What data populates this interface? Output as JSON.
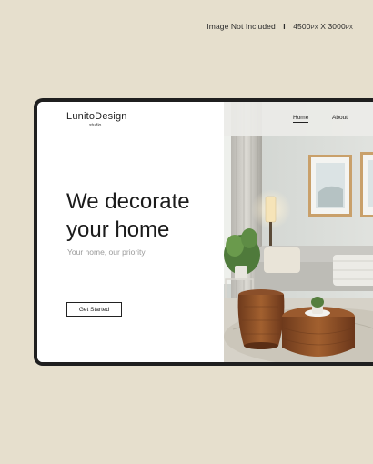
{
  "caption": {
    "text": "Image Not Included",
    "separator": "I",
    "dims_a": "4500",
    "unit_a": "PX",
    "times": " X ",
    "dims_b": "3000",
    "unit_b": "PX"
  },
  "brand": {
    "name": "LunitoDesign",
    "tagline": "studio"
  },
  "hero": {
    "title_line1": "We decorate",
    "title_line2": "your home",
    "subtitle": "Your home, our priority",
    "cta_label": "Get Started"
  },
  "nav": {
    "items": [
      {
        "label": "Home",
        "active": true
      },
      {
        "label": "About",
        "active": false
      }
    ]
  },
  "colors": {
    "background": "#e6dfcd",
    "device_frame": "#1f1f1f",
    "wood": "#8a4f2a"
  }
}
